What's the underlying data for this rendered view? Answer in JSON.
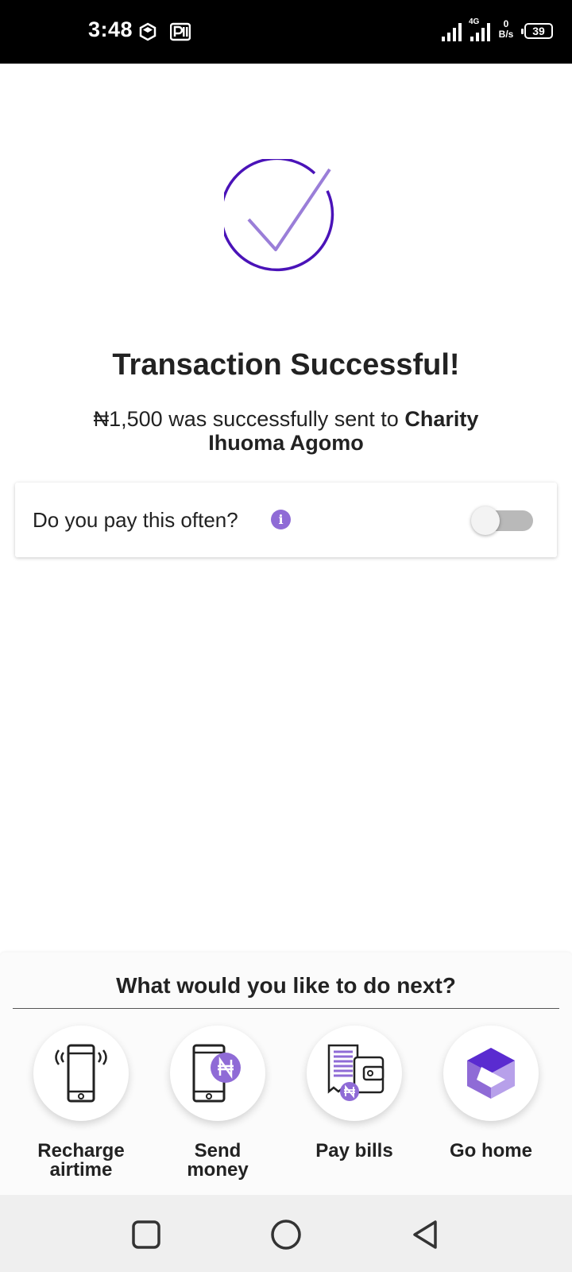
{
  "status_bar": {
    "time": "3:48",
    "network": "4G",
    "speed_value": "0",
    "speed_unit": "B/s",
    "battery": "39"
  },
  "success": {
    "title": "Transaction Successful!",
    "amount_text": "₦1,500 was successfully sent to",
    "recipient": "Charity Ihuoma Agomo"
  },
  "often_card": {
    "label": "Do you pay this often?",
    "info_glyph": "i",
    "toggle_on": false
  },
  "next_panel": {
    "title": "What would you like to do next?",
    "actions": [
      {
        "label": "Recharge\nairtime",
        "icon": "phone-signal-icon"
      },
      {
        "label": "Send\nmoney",
        "icon": "phone-naira-icon"
      },
      {
        "label": "Pay bills",
        "icon": "bill-wallet-icon"
      },
      {
        "label": "Go home",
        "icon": "app-logo-icon"
      }
    ]
  },
  "colors": {
    "accent": "#8f6bd6",
    "accent_dark": "#4a13b8",
    "toggle_off": "#b9b9b9"
  }
}
